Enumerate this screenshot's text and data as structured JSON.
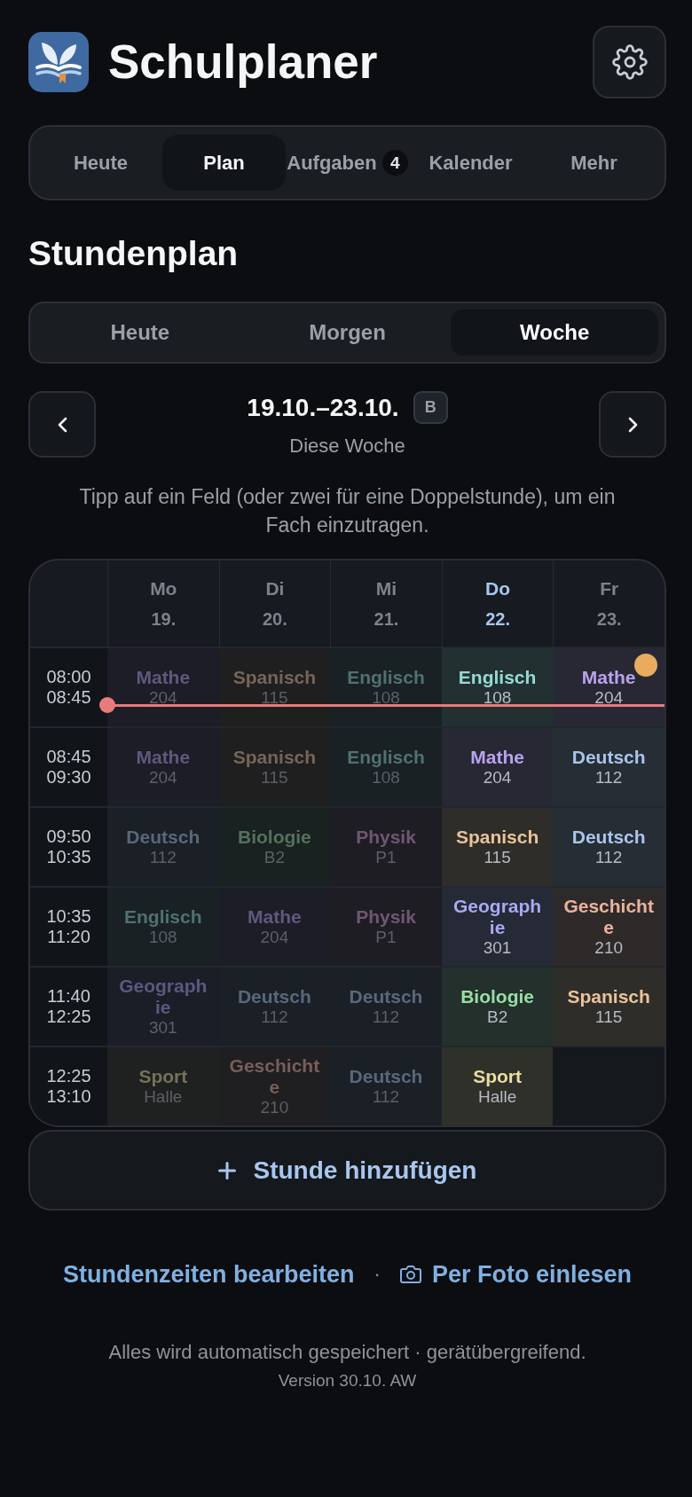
{
  "app": {
    "title": "Schulplaner"
  },
  "nav_tabs": [
    {
      "label": "Heute",
      "selected": false
    },
    {
      "label": "Plan",
      "selected": true
    },
    {
      "label": "Aufgaben",
      "selected": false,
      "badge": "4"
    },
    {
      "label": "Kalender",
      "selected": false
    },
    {
      "label": "Mehr",
      "selected": false
    }
  ],
  "section": {
    "title": "Stundenplan"
  },
  "view_tabs": [
    {
      "label": "Heute",
      "selected": false
    },
    {
      "label": "Morgen",
      "selected": false
    },
    {
      "label": "Woche",
      "selected": true
    }
  ],
  "week_nav": {
    "range": "19.10.–23.10.",
    "week_badge": "B",
    "caption": "Diese Woche"
  },
  "hint": "Tipp auf ein Feld (oder zwei für eine Doppelstunde), um ein Fach einzutragen.",
  "timetable": {
    "days": [
      {
        "name": "Mo",
        "date": "19.",
        "past": true,
        "today": false
      },
      {
        "name": "Di",
        "date": "20.",
        "past": true,
        "today": false
      },
      {
        "name": "Mi",
        "date": "21.",
        "past": true,
        "today": false
      },
      {
        "name": "Do",
        "date": "22.",
        "past": false,
        "today": true
      },
      {
        "name": "Fr",
        "date": "23.",
        "past": false,
        "today": false
      }
    ],
    "periods": [
      {
        "start": "08:00",
        "end": "08:45",
        "current": true,
        "cells": [
          {
            "kind": "lesson",
            "subject": "Mathe",
            "room": "204",
            "color": "#60587d",
            "dot": false
          },
          {
            "kind": "lesson",
            "subject": "Spanisch",
            "room": "115",
            "color": "#766658",
            "dot": false
          },
          {
            "kind": "lesson",
            "subject": "Englisch",
            "room": "108",
            "color": "#507172",
            "dot": false
          },
          {
            "kind": "lesson",
            "subject": "Englisch",
            "room": "108",
            "color": "#94dbd3",
            "dot": false
          },
          {
            "kind": "lesson",
            "subject": "Mathe",
            "room": "204",
            "color": "#b9a3ec",
            "dot": true
          }
        ]
      },
      {
        "start": "08:45",
        "end": "09:30",
        "current": false,
        "cells": [
          {
            "kind": "lesson",
            "subject": "Mathe",
            "room": "204",
            "color": "#60587d",
            "dot": false
          },
          {
            "kind": "lesson",
            "subject": "Spanisch",
            "room": "115",
            "color": "#766658",
            "dot": false
          },
          {
            "kind": "lesson",
            "subject": "Englisch",
            "room": "108",
            "color": "#507172",
            "dot": false
          },
          {
            "kind": "lesson",
            "subject": "Mathe",
            "room": "204",
            "color": "#b9a3ec",
            "dot": false
          },
          {
            "kind": "lesson",
            "subject": "Deutsch",
            "room": "112",
            "color": "#a9c5ec",
            "dot": false
          }
        ]
      },
      {
        "start": "09:50",
        "end": "10:35",
        "current": false,
        "cells": [
          {
            "kind": "lesson",
            "subject": "Deutsch",
            "room": "112",
            "color": "#59677d",
            "dot": false
          },
          {
            "kind": "lesson",
            "subject": "Biologie",
            "room": "B2",
            "color": "#52725d",
            "dot": false
          },
          {
            "kind": "lesson",
            "subject": "Physik",
            "room": "P1",
            "color": "#6f5771",
            "dot": false
          },
          {
            "kind": "lesson",
            "subject": "Spanisch",
            "room": "115",
            "color": "#e9c39b",
            "dot": false
          },
          {
            "kind": "lesson",
            "subject": "Deutsch",
            "room": "112",
            "color": "#a9c5ec",
            "dot": false
          }
        ]
      },
      {
        "start": "10:35",
        "end": "11:20",
        "current": false,
        "cells": [
          {
            "kind": "lesson",
            "subject": "Englisch",
            "room": "108",
            "color": "#507172",
            "dot": false
          },
          {
            "kind": "lesson",
            "subject": "Mathe",
            "room": "204",
            "color": "#60587d",
            "dot": false
          },
          {
            "kind": "lesson",
            "subject": "Physik",
            "room": "P1",
            "color": "#6f5771",
            "dot": false
          },
          {
            "kind": "lesson",
            "subject": "Geographie",
            "room": "301",
            "color": "#a9a9f2",
            "dot": false
          },
          {
            "kind": "lesson",
            "subject": "Geschichte",
            "room": "210",
            "color": "#ebb39c",
            "dot": false
          }
        ]
      },
      {
        "start": "11:40",
        "end": "12:25",
        "current": false,
        "cells": [
          {
            "kind": "lesson",
            "subject": "Geographie",
            "room": "301",
            "color": "#595a80",
            "dot": false
          },
          {
            "kind": "lesson",
            "subject": "Deutsch",
            "room": "112",
            "color": "#59677d",
            "dot": false
          },
          {
            "kind": "lesson",
            "subject": "Deutsch",
            "room": "112",
            "color": "#59677d",
            "dot": false
          },
          {
            "kind": "lesson",
            "subject": "Biologie",
            "room": "B2",
            "color": "#98dea5",
            "dot": false
          },
          {
            "kind": "lesson",
            "subject": "Spanisch",
            "room": "115",
            "color": "#e9c39b",
            "dot": false
          }
        ]
      },
      {
        "start": "12:25",
        "end": "13:10",
        "current": false,
        "cells": [
          {
            "kind": "lesson",
            "subject": "Sport",
            "room": "Halle",
            "color": "#76725a",
            "dot": false
          },
          {
            "kind": "lesson",
            "subject": "Geschichte",
            "room": "210",
            "color": "#775f59",
            "dot": false
          },
          {
            "kind": "lesson",
            "subject": "Deutsch",
            "room": "112",
            "color": "#59677d",
            "dot": false
          },
          {
            "kind": "lesson",
            "subject": "Sport",
            "room": "Halle",
            "color": "#e9dd9f",
            "dot": false
          },
          {
            "kind": "empty"
          }
        ]
      }
    ]
  },
  "add_button": {
    "label": "Stunde hinzufügen"
  },
  "links_row": {
    "items": [
      {
        "kind": "text",
        "label": "Stundenzeiten bearbeiten"
      },
      {
        "kind": "photo",
        "label": "Per Foto einlesen"
      }
    ],
    "separator": "·"
  },
  "footer": {
    "note": "Alles wird automatisch gespeichert · gerätübergreifend.",
    "version": "Version 30.10. AW"
  }
}
